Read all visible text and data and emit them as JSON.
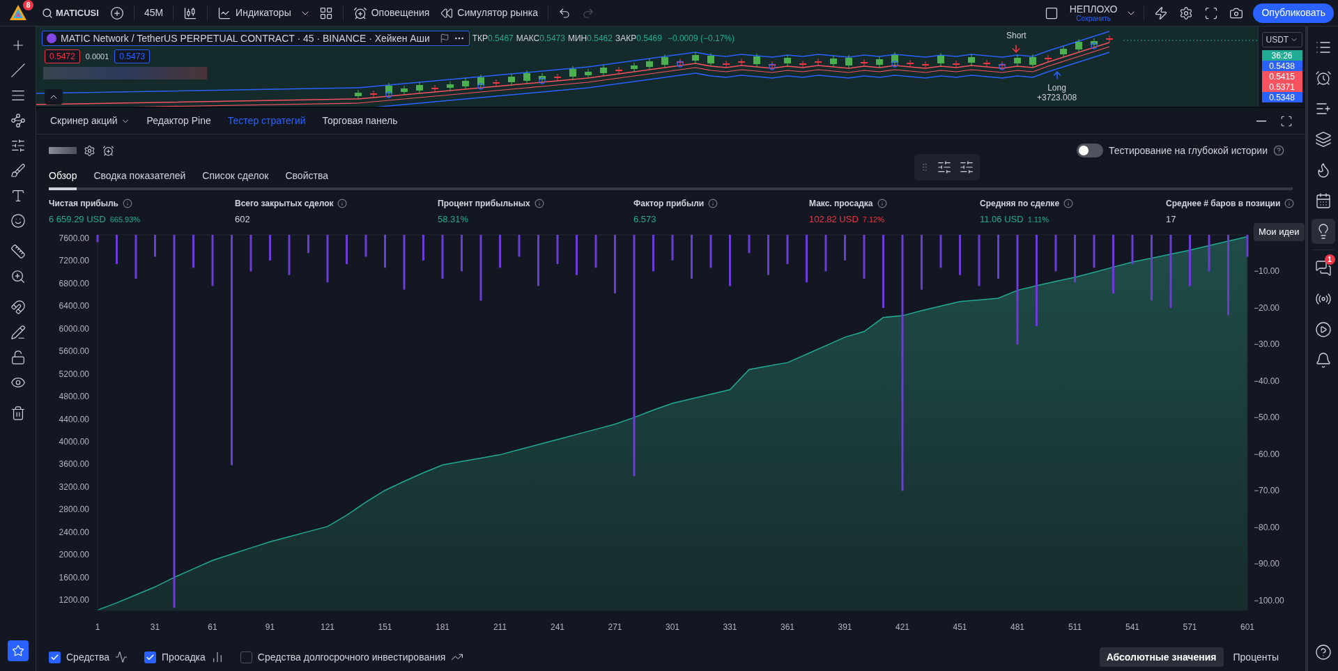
{
  "top_bar": {
    "logo_badge": "8",
    "symbol": "MATICUSI",
    "interval": "45M",
    "indicators": "Индикаторы",
    "alerts": "Оповещения",
    "replay": "Симулятор рынка",
    "undo": {
      "disabled": false
    },
    "redo": {
      "disabled": true
    },
    "layout_name": "НЕПЛОХО",
    "save_label": "Сохранить",
    "publish": "Опубликовать"
  },
  "chart": {
    "title": "MATIC Network / TetherUS PERPETUAL CONTRACT · 45 · BINANCE · Хейкен Аши",
    "ohlc": [
      {
        "label": "ТКР",
        "value": "0.5467"
      },
      {
        "label": "МАКС",
        "value": "0.5473"
      },
      {
        "label": "МИН",
        "value": "0.5462"
      },
      {
        "label": "ЗАКР",
        "value": "0.5469"
      }
    ],
    "change": "−0.0009 (−0.17%)",
    "sell_price": "0.5472",
    "spread": "0.0001",
    "buy_price": "0.5473",
    "currency": "USDT",
    "price_tags": [
      {
        "text": "36:26",
        "color": "#22ab94"
      },
      {
        "text": "0.5438",
        "color": "#2962ff"
      },
      {
        "text": "0.5415",
        "color": "#f7525f"
      },
      {
        "text": "0.5371",
        "color": "#f7525f"
      },
      {
        "text": "0.5348",
        "color": "#2962ff"
      }
    ],
    "signals": [
      {
        "kind": "short",
        "label": "Short"
      },
      {
        "kind": "long",
        "label": "Long",
        "profit": "+3723.008"
      }
    ]
  },
  "panel": {
    "tabs": [
      {
        "label": "Скринер акций",
        "selected": false,
        "dropdown": true
      },
      {
        "label": "Редактор Pine",
        "selected": false,
        "dropdown": false
      },
      {
        "label": "Тестер стратегий",
        "selected": true,
        "dropdown": false
      },
      {
        "label": "Торговая панель",
        "selected": false,
        "dropdown": false
      }
    ],
    "deep_backtest": {
      "label": "Тестирование на глубокой истории",
      "on": false
    },
    "subtabs": [
      {
        "label": "Обзор",
        "selected": true
      },
      {
        "label": "Сводка показателей",
        "selected": false
      },
      {
        "label": "Список сделок",
        "selected": false
      },
      {
        "label": "Свойства",
        "selected": false
      }
    ],
    "metrics": [
      {
        "label": "Чистая прибыль",
        "value": "6 659.29 USD",
        "percent": "665.93%",
        "kind": "profit"
      },
      {
        "label": "Всего закрытых сделок",
        "value": "602",
        "kind": "neutral"
      },
      {
        "label": "Процент прибыльных",
        "value": "58.31%",
        "kind": "profit"
      },
      {
        "label": "Фактор прибыли",
        "value": "6.573",
        "kind": "profit"
      },
      {
        "label": "Макс. просадка",
        "value": "102.82 USD",
        "percent": "7.12%",
        "kind": "loss"
      },
      {
        "label": "Средняя по сделке",
        "value": "11.06 USD",
        "percent": "1.11%",
        "kind": "profit"
      },
      {
        "label": "Среднее # баров в позиции",
        "value": "17",
        "kind": "neutral"
      }
    ],
    "equity_chart": {
      "chart_data": {
        "type": "area",
        "x": [
          1,
          11,
          21,
          31,
          41,
          51,
          61,
          71,
          81,
          91,
          101,
          111,
          121,
          131,
          141,
          151,
          161,
          171,
          181,
          191,
          201,
          211,
          221,
          231,
          241,
          251,
          261,
          271,
          281,
          291,
          301,
          311,
          321,
          331,
          341,
          351,
          361,
          371,
          381,
          391,
          401,
          411,
          421,
          431,
          441,
          451,
          461,
          471,
          481,
          491,
          501,
          511,
          521,
          531,
          541,
          551,
          561,
          571,
          581,
          591,
          601
        ],
        "xlim": [
          1,
          601
        ],
        "ylim": [
          1015,
          7662
        ],
        "series": [
          {
            "color": "#22ab94",
            "values": [
              1020,
              1150,
              1290,
              1430,
              1600,
              1750,
              1900,
              2010,
              2120,
              2230,
              2320,
              2410,
              2500,
              2700,
              2930,
              3140,
              3300,
              3450,
              3590,
              3650,
              3710,
              3770,
              3860,
              3950,
              4040,
              4130,
              4220,
              4310,
              4430,
              4560,
              4680,
              4760,
              4840,
              4920,
              5280,
              5340,
              5400,
              5550,
              5700,
              5850,
              5950,
              6200,
              6230,
              6320,
              6400,
              6480,
              6510,
              6540,
              6680,
              6760,
              6840,
              6910,
              7000,
              7090,
              7180,
              7250,
              7320,
              7390,
              7470,
              7550,
              7630
            ]
          }
        ],
        "yticks": [
          {
            "value": 1200,
            "label": "1200.00"
          },
          {
            "value": 1600,
            "label": "1600.00"
          },
          {
            "value": 2000,
            "label": "2000.00"
          },
          {
            "value": 2400,
            "label": "2400.00"
          },
          {
            "value": 2800,
            "label": "2800.00"
          },
          {
            "value": 3200,
            "label": "3200.00"
          },
          {
            "value": 3600,
            "label": "3600.00"
          },
          {
            "value": 4000,
            "label": "4000.00"
          },
          {
            "value": 4400,
            "label": "4400.00"
          },
          {
            "value": 4800,
            "label": "4800.00"
          },
          {
            "value": 5200,
            "label": "5200.00"
          },
          {
            "value": 5600,
            "label": "5600.00"
          },
          {
            "value": 6000,
            "label": "6000.00"
          },
          {
            "value": 6400,
            "label": "6400.00"
          },
          {
            "value": 6800,
            "label": "6800.00"
          },
          {
            "value": 7200,
            "label": "7200.00"
          },
          {
            "value": 7600,
            "label": "7600.00"
          }
        ]
      }
    },
    "drawdown_chart": {
      "chart_data": {
        "type": "bar",
        "x": [
          1,
          11,
          21,
          31,
          41,
          51,
          61,
          71,
          81,
          91,
          101,
          111,
          121,
          131,
          141,
          151,
          161,
          171,
          181,
          191,
          201,
          211,
          221,
          231,
          241,
          251,
          261,
          271,
          281,
          291,
          301,
          311,
          321,
          331,
          341,
          351,
          361,
          371,
          381,
          391,
          401,
          411,
          421,
          431,
          441,
          451,
          461,
          471,
          481,
          491,
          501,
          511,
          521,
          531,
          541,
          551,
          561,
          571,
          581,
          591,
          601
        ],
        "xlim": [
          1,
          601
        ],
        "ylim": [
          -102.7,
          0
        ],
        "xticks": [
          1,
          31,
          61,
          91,
          121,
          151,
          181,
          211,
          241,
          271,
          301,
          331,
          361,
          391,
          421,
          451,
          481,
          511,
          541,
          571,
          601
        ],
        "series": [
          {
            "color": "#6d3bd6",
            "values": [
              -2,
              -8,
              -12,
              -6,
              -102,
              -9,
              -14,
              -63,
              -10,
              -7,
              -11,
              -5,
              -13,
              -8,
              -6,
              -9,
              -15,
              -7,
              -12,
              -10,
              -18,
              -9,
              -6,
              -14,
              -8,
              -11,
              -9,
              -16,
              -66,
              -10,
              -7,
              -12,
              -9,
              -14,
              -5,
              -11,
              -8,
              -13,
              -10,
              -7,
              -12,
              -20,
              -70,
              -15,
              -9,
              -11,
              -14,
              -12,
              -30,
              -25,
              -10,
              -13,
              -9,
              -16,
              -8,
              -18,
              -20,
              -14,
              -10,
              -22,
              -6
            ]
          }
        ],
        "yticks": [
          {
            "value": -10,
            "label": "−10.00"
          },
          {
            "value": -20,
            "label": "−20.00"
          },
          {
            "value": -30,
            "label": "−30.00"
          },
          {
            "value": -40,
            "label": "−40.00"
          },
          {
            "value": -50,
            "label": "−50.00"
          },
          {
            "value": -60,
            "label": "−60.00"
          },
          {
            "value": -70,
            "label": "−70.00"
          },
          {
            "value": -80,
            "label": "−80.00"
          },
          {
            "value": -90,
            "label": "−90.00"
          },
          {
            "value": -100,
            "label": "−100.00"
          }
        ]
      }
    },
    "legend": [
      {
        "label": "Средства",
        "checked": true
      },
      {
        "label": "Просадка",
        "checked": true
      },
      {
        "label": "Средства долгосрочного инвестирования",
        "checked": false
      }
    ],
    "value_modes": [
      {
        "label": "Абсолютные значения",
        "selected": true
      },
      {
        "label": "Проценты",
        "selected": false
      }
    ]
  },
  "right_sidebar": {
    "tooltip": "Мои идеи",
    "items": [
      {
        "selected": false
      },
      {
        "selected": false
      },
      {
        "selected": false
      },
      {
        "selected": false
      },
      {
        "selected": false
      },
      {
        "selected": false
      },
      {
        "selected": true
      },
      {
        "selected": false,
        "badge": "1"
      },
      {
        "selected": false
      },
      {
        "selected": false
      },
      {
        "selected": false
      }
    ]
  }
}
